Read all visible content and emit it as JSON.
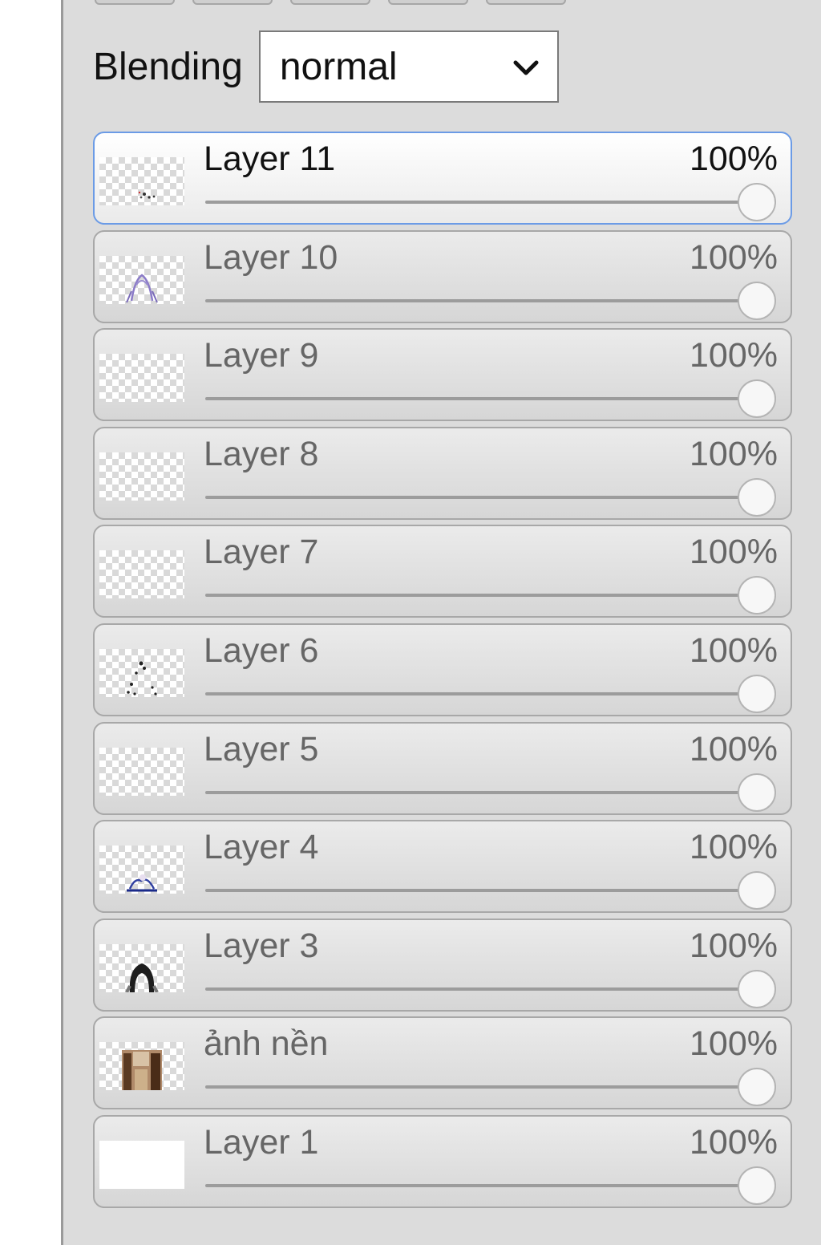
{
  "blending": {
    "label": "Blending",
    "selected": "normal",
    "icon": "chevron-down-icon"
  },
  "layers": [
    {
      "name": "Layer 11",
      "opacity_label": "100%",
      "opacity": 1.0,
      "active": true,
      "thumbnail": "sketch-dots"
    },
    {
      "name": "Layer 10",
      "opacity_label": "100%",
      "opacity": 1.0,
      "active": false,
      "thumbnail": "purple-figure"
    },
    {
      "name": "Layer 9",
      "opacity_label": "100%",
      "opacity": 1.0,
      "active": false,
      "thumbnail": "empty"
    },
    {
      "name": "Layer 8",
      "opacity_label": "100%",
      "opacity": 1.0,
      "active": false,
      "thumbnail": "empty"
    },
    {
      "name": "Layer 7",
      "opacity_label": "100%",
      "opacity": 1.0,
      "active": false,
      "thumbnail": "empty"
    },
    {
      "name": "Layer 6",
      "opacity_label": "100%",
      "opacity": 1.0,
      "active": false,
      "thumbnail": "black-dots"
    },
    {
      "name": "Layer 5",
      "opacity_label": "100%",
      "opacity": 1.0,
      "active": false,
      "thumbnail": "empty"
    },
    {
      "name": "Layer 4",
      "opacity_label": "100%",
      "opacity": 1.0,
      "active": false,
      "thumbnail": "blue-figure"
    },
    {
      "name": "Layer 3",
      "opacity_label": "100%",
      "opacity": 1.0,
      "active": false,
      "thumbnail": "dark-hair"
    },
    {
      "name": "ảnh nền",
      "opacity_label": "100%",
      "opacity": 1.0,
      "active": false,
      "thumbnail": "background-photo"
    },
    {
      "name": "Layer 1",
      "opacity_label": "100%",
      "opacity": 1.0,
      "active": false,
      "thumbnail": "white-fill"
    }
  ]
}
